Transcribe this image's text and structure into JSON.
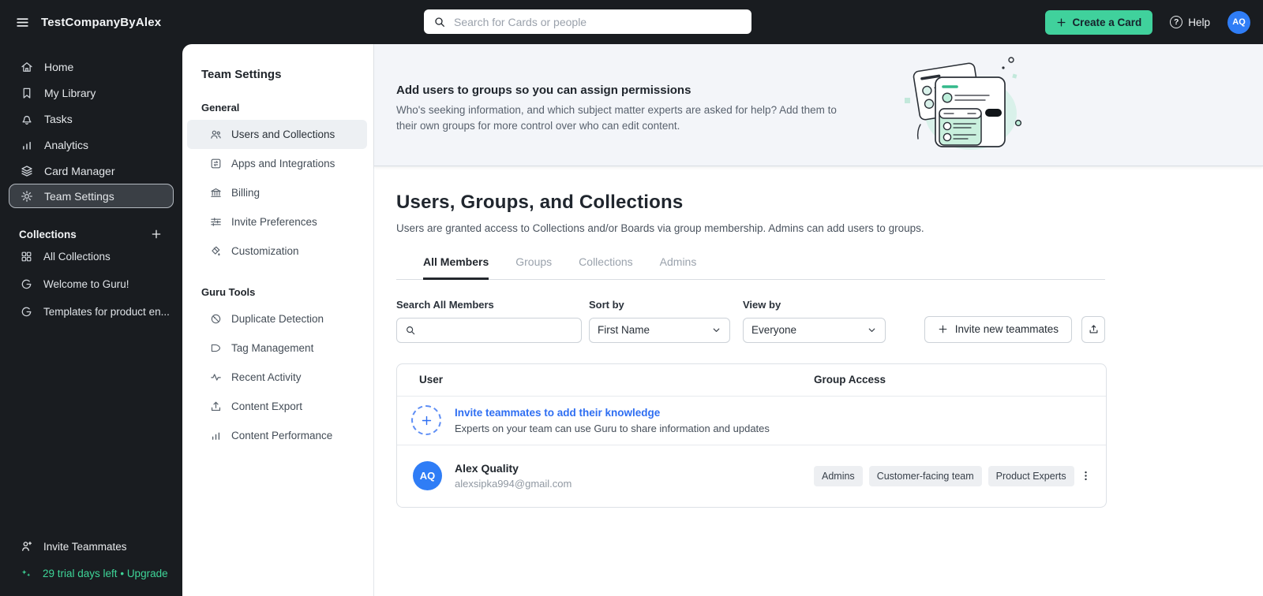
{
  "colors": {
    "sidebar_bg": "#191c20",
    "accent_green": "#40d19c",
    "trial_green": "#3ed598",
    "avatar_blue": "#2f7df6",
    "link_blue": "#2e6ef2",
    "banner_bg": "#f3f5f9"
  },
  "topbar": {
    "brand": "TestCompanyByAlex",
    "search_placeholder": "Search for Cards or people",
    "create_card_label": "Create a Card",
    "help_label": "Help",
    "avatar_initials": "AQ"
  },
  "sidebar": {
    "items": [
      {
        "label": "Home"
      },
      {
        "label": "My Library"
      },
      {
        "label": "Tasks"
      },
      {
        "label": "Analytics"
      },
      {
        "label": "Card Manager"
      },
      {
        "label": "Team Settings"
      }
    ],
    "collections": {
      "label": "Collections",
      "items": [
        {
          "label": "All Collections"
        },
        {
          "label": "Welcome to Guru!"
        },
        {
          "label": "Templates for product en..."
        }
      ]
    },
    "footer": {
      "invite_label": "Invite Teammates",
      "trial_text": "29 trial days left",
      "separator": "•",
      "upgrade_label": "Upgrade"
    }
  },
  "settings_nav": {
    "title": "Team Settings",
    "sections": [
      {
        "label": "General",
        "items": [
          {
            "label": "Users and Collections"
          },
          {
            "label": "Apps and Integrations"
          },
          {
            "label": "Billing"
          },
          {
            "label": "Invite Preferences"
          },
          {
            "label": "Customization"
          }
        ]
      },
      {
        "label": "Guru Tools",
        "items": [
          {
            "label": "Duplicate Detection"
          },
          {
            "label": "Tag Management"
          },
          {
            "label": "Recent Activity"
          },
          {
            "label": "Content Export"
          },
          {
            "label": "Content Performance"
          }
        ]
      }
    ]
  },
  "banner": {
    "title": "Add users to groups so you can assign permissions",
    "description": "Who's seeking information, and which subject matter experts are asked for help? Add them to their own groups for more control over who can edit content."
  },
  "main": {
    "title": "Users, Groups, and Collections",
    "subtitle": "Users are granted access to Collections and/or Boards via group membership. Admins can add users to groups.",
    "tabs": [
      {
        "label": "All Members"
      },
      {
        "label": "Groups"
      },
      {
        "label": "Collections"
      },
      {
        "label": "Admins"
      }
    ],
    "filters": {
      "search_label": "Search All Members",
      "sort_label": "Sort by",
      "sort_value": "First Name",
      "view_label": "View by",
      "view_value": "Everyone",
      "invite_button_label": "Invite new teammates"
    },
    "table": {
      "columns": {
        "user": "User",
        "group_access": "Group Access"
      },
      "invite_row": {
        "title": "Invite teammates to add their knowledge",
        "subtitle": "Experts on your team can use Guru to share information and updates"
      },
      "user_row": {
        "initials": "AQ",
        "name": "Alex Quality",
        "email": "alexsipka994@gmail.com",
        "groups": [
          {
            "label": "Admins"
          },
          {
            "label": "Customer-facing team"
          },
          {
            "label": "Product Experts"
          }
        ]
      }
    }
  }
}
